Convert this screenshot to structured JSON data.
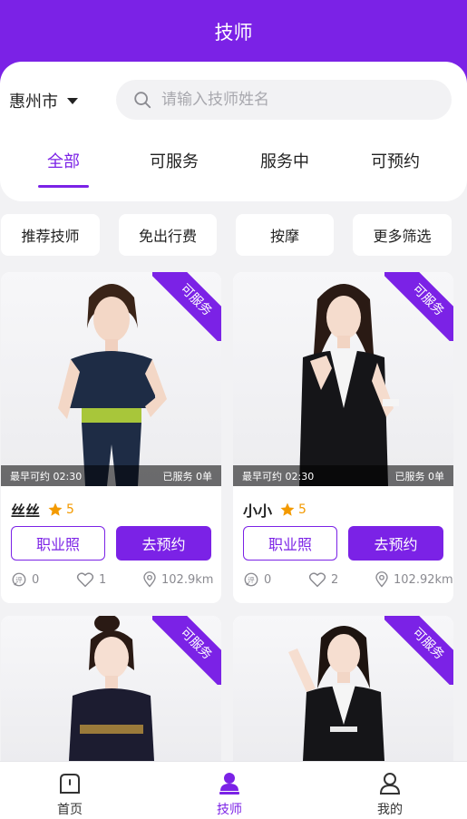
{
  "header": {
    "title": "技师"
  },
  "location": {
    "city": "惠州市"
  },
  "search": {
    "placeholder": "请输入技师姓名",
    "value": ""
  },
  "tabs": [
    {
      "label": "全部",
      "active": true
    },
    {
      "label": "可服务",
      "active": false
    },
    {
      "label": "服务中",
      "active": false
    },
    {
      "label": "可预约",
      "active": false
    }
  ],
  "filters": [
    "推荐技师",
    "免出行费",
    "按摩",
    "更多筛选"
  ],
  "cards": [
    {
      "status_ribbon": "可服务",
      "earliest": "最早可约 02:30",
      "served": "已服务 0单",
      "name": "丝丝",
      "rating": "5",
      "btn_license": "职业照",
      "btn_book": "去预约",
      "comments": "0",
      "likes": "1",
      "distance": "102.9km"
    },
    {
      "status_ribbon": "可服务",
      "earliest": "最早可约 02:30",
      "served": "已服务 0单",
      "name": "小小",
      "rating": "5",
      "btn_license": "职业照",
      "btn_book": "去预约",
      "comments": "0",
      "likes": "2",
      "distance": "102.92km"
    },
    {
      "status_ribbon": "可服务"
    },
    {
      "status_ribbon": "可服务"
    }
  ],
  "bottom_nav": [
    {
      "label": "首页",
      "icon": "home-icon",
      "active": false
    },
    {
      "label": "技师",
      "icon": "technician-icon",
      "active": true
    },
    {
      "label": "我的",
      "icon": "profile-icon",
      "active": false
    }
  ],
  "colors": {
    "accent": "#7b22e6",
    "rating": "#f39a00",
    "background": "#f2f2f4"
  }
}
